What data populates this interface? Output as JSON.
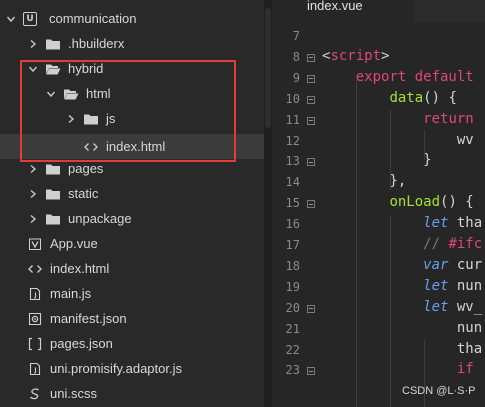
{
  "explorer": {
    "items": [
      {
        "label": "communication",
        "icon": "project-root-icon",
        "chevron": "down"
      },
      {
        "label": ".hbuilderx",
        "icon": "folder-icon",
        "chevron": "right"
      },
      {
        "label": "hybrid",
        "icon": "folder-open-icon",
        "chevron": "down"
      },
      {
        "label": "html",
        "icon": "folder-open-icon",
        "chevron": "down"
      },
      {
        "label": "js",
        "icon": "folder-icon",
        "chevron": "right"
      },
      {
        "label": "index.html",
        "icon": "code-file-icon",
        "chevron": ""
      },
      {
        "label": "pages",
        "icon": "folder-icon",
        "chevron": "right"
      },
      {
        "label": "static",
        "icon": "folder-icon",
        "chevron": "right"
      },
      {
        "label": "unpackage",
        "icon": "folder-icon",
        "chevron": "right"
      },
      {
        "label": "App.vue",
        "icon": "vue-file-icon",
        "chevron": ""
      },
      {
        "label": "index.html",
        "icon": "code-file-icon",
        "chevron": ""
      },
      {
        "label": "main.js",
        "icon": "js-file-icon",
        "chevron": ""
      },
      {
        "label": "manifest.json",
        "icon": "gear-file-icon",
        "chevron": ""
      },
      {
        "label": "pages.json",
        "icon": "bracket-file-icon",
        "chevron": ""
      },
      {
        "label": "uni.promisify.adaptor.js",
        "icon": "js-file-icon",
        "chevron": ""
      },
      {
        "label": "uni.scss",
        "icon": "scss-file-icon",
        "chevron": ""
      }
    ],
    "selected_item": "index.html",
    "highlight_color": "#e33b35"
  },
  "editor": {
    "tab_title": "index.vue",
    "lines": [
      {
        "n": "7",
        "text": ""
      },
      {
        "n": "8",
        "text": "<script>"
      },
      {
        "n": "9",
        "text": "    export default"
      },
      {
        "n": "10",
        "text": "        data() {"
      },
      {
        "n": "11",
        "text": "            return"
      },
      {
        "n": "12",
        "text": "                wv"
      },
      {
        "n": "13",
        "text": "            }"
      },
      {
        "n": "14",
        "text": "        },"
      },
      {
        "n": "15",
        "text": "        onLoad() {"
      },
      {
        "n": "16",
        "text": "            let tha"
      },
      {
        "n": "17",
        "text": "            // #ifc"
      },
      {
        "n": "18",
        "text": "            var cur"
      },
      {
        "n": "19",
        "text": "            let nun"
      },
      {
        "n": "20",
        "text": "            let wv_"
      },
      {
        "n": "21",
        "text": "                nun"
      },
      {
        "n": "22",
        "text": "                tha"
      },
      {
        "n": "23",
        "text": "                if"
      }
    ]
  },
  "watermark": "CSDN @L·S·P",
  "colors": {
    "keyword": "#e0457b",
    "italic_keyword": "#6b9df0",
    "function": "#a6e22e",
    "comment": "#787878"
  }
}
